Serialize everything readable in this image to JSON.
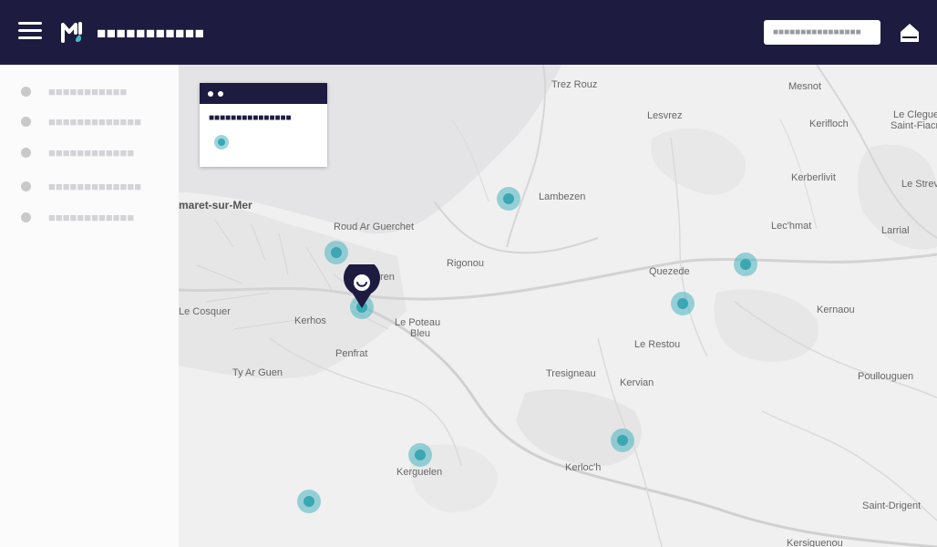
{
  "header": {
    "app_title": "■■■■■■■■■■■",
    "search_placeholder": "■■■■■■■■■■■■■■■■",
    "menu_icon": "hamburger-menu-icon",
    "logo_icon": "app-logo-icon",
    "home_icon": "home-icon",
    "background_color": "#1d1b3f"
  },
  "sidebar": {
    "items": [
      {
        "label": "■■■■■■■■■■■"
      },
      {
        "label": "■■■■■■■■■■■■■"
      },
      {
        "label": "■■■■■■■■■■■■"
      },
      {
        "label": "■■■■■■■■■■■■■"
      },
      {
        "label": "■■■■■■■■■■■■"
      }
    ]
  },
  "popup": {
    "title": "■■■■■■■■■■■■■■■"
  },
  "map": {
    "place_names": [
      "Trez Rouz",
      "Mesnot",
      "Lesvrez",
      "Kerifloch",
      "Le Clegueu",
      "Saint-Fiacr",
      "Kerberlivit",
      "Le Strev",
      "maret-sur-Mer",
      "Lambezen",
      "Roud Ar Guerchet",
      "Lec'hmat",
      "Larrial",
      "Rigonou",
      "Quezede",
      "Kernaou",
      "Le Cosquer",
      "Kerhos",
      "Le Poteau",
      "Bleu",
      "Le Restou",
      "Penfrat",
      "Ty Ar Guen",
      "Tresigneau",
      "Kervian",
      "Poullouguen",
      "Kerguelen",
      "Kerloc'h",
      "Saint-Drigent",
      "Kersiguenou",
      "ren"
    ],
    "marker_accent": "#3aa7b3",
    "pin_color": "#1d1b3f"
  }
}
